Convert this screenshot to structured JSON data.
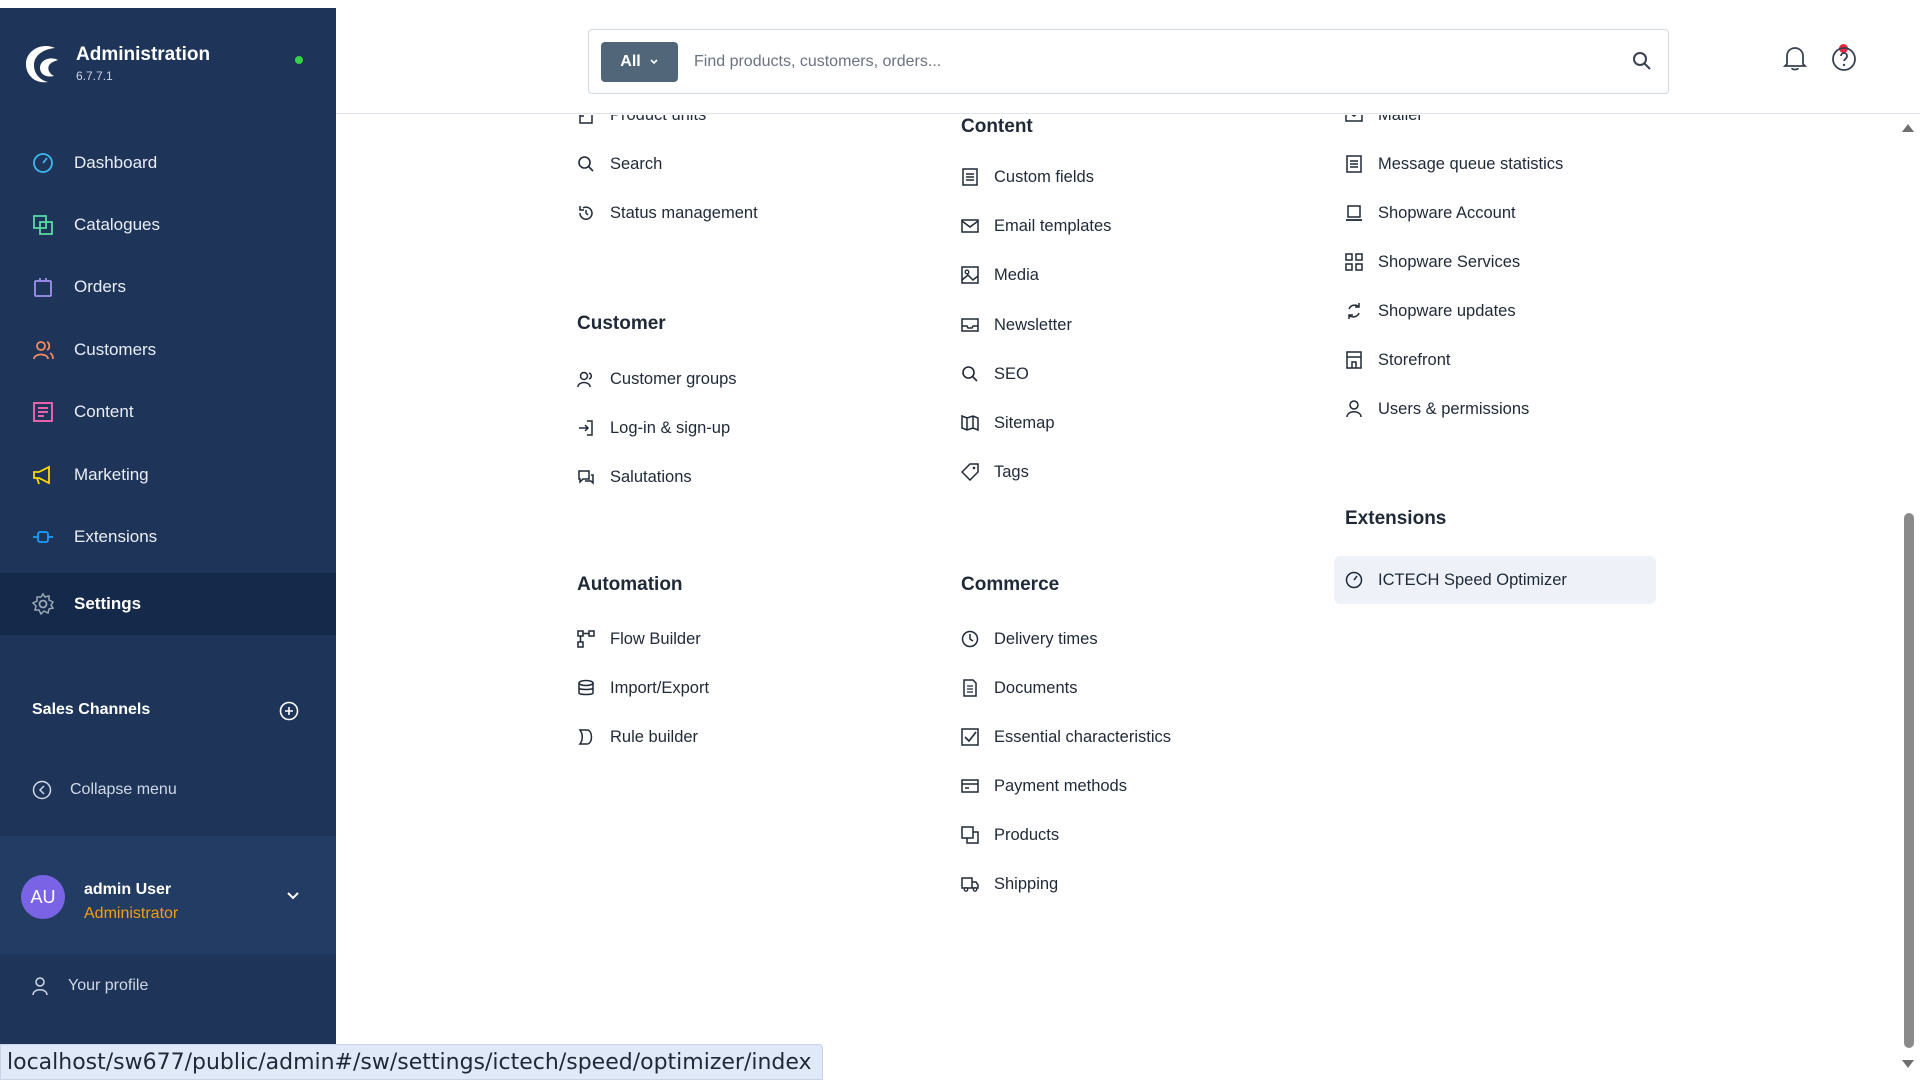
{
  "app": {
    "name": "Administration",
    "version": "6.7.7.1"
  },
  "sidebar": {
    "items": [
      {
        "label": "Dashboard",
        "icon": "gauge-icon",
        "color": "#3db8f0"
      },
      {
        "label": "Catalogues",
        "icon": "catalogue-icon",
        "color": "#57d9a3"
      },
      {
        "label": "Orders",
        "icon": "bag-icon",
        "color": "#a092f0"
      },
      {
        "label": "Customers",
        "icon": "users-icon",
        "color": "#f88962"
      },
      {
        "label": "Content",
        "icon": "content-icon",
        "color": "#ff68b4"
      },
      {
        "label": "Marketing",
        "icon": "megaphone-icon",
        "color": "#ffd700"
      },
      {
        "label": "Extensions",
        "icon": "plug-icon",
        "color": "#189eff"
      },
      {
        "label": "Settings",
        "icon": "gear-icon",
        "color": "#9aa8b5"
      }
    ],
    "sales_channels": "Sales Channels",
    "collapse": "Collapse menu",
    "user": {
      "initials": "AU",
      "name": "admin User",
      "role": "Administrator"
    },
    "profile": "Your profile"
  },
  "header": {
    "search_scope": "All",
    "search_placeholder": "Find products, customers, orders..."
  },
  "settings": {
    "col1_top": [
      "Product units",
      "Search",
      "Status management"
    ],
    "customer": {
      "title": "Customer",
      "items": [
        "Customer groups",
        "Log-in & sign-up",
        "Salutations"
      ]
    },
    "automation": {
      "title": "Automation",
      "items": [
        "Flow Builder",
        "Import/Export",
        "Rule builder"
      ]
    },
    "content": {
      "title": "Content",
      "items": [
        "Custom fields",
        "Email templates",
        "Media",
        "Newsletter",
        "SEO",
        "Sitemap",
        "Tags"
      ]
    },
    "commerce": {
      "title": "Commerce",
      "items": [
        "Delivery times",
        "Documents",
        "Essential characteristics",
        "Payment methods",
        "Products",
        "Shipping"
      ]
    },
    "col3_top": [
      "Mailer",
      "Message queue statistics",
      "Shopware Account",
      "Shopware Services",
      "Shopware updates",
      "Storefront",
      "Users & permissions"
    ],
    "extensions": {
      "title": "Extensions",
      "items": [
        "ICTECH Speed Optimizer"
      ]
    }
  },
  "statusbar": {
    "url": "localhost/sw677/public/admin#/sw/settings/ictech/speed/optimizer/index"
  }
}
